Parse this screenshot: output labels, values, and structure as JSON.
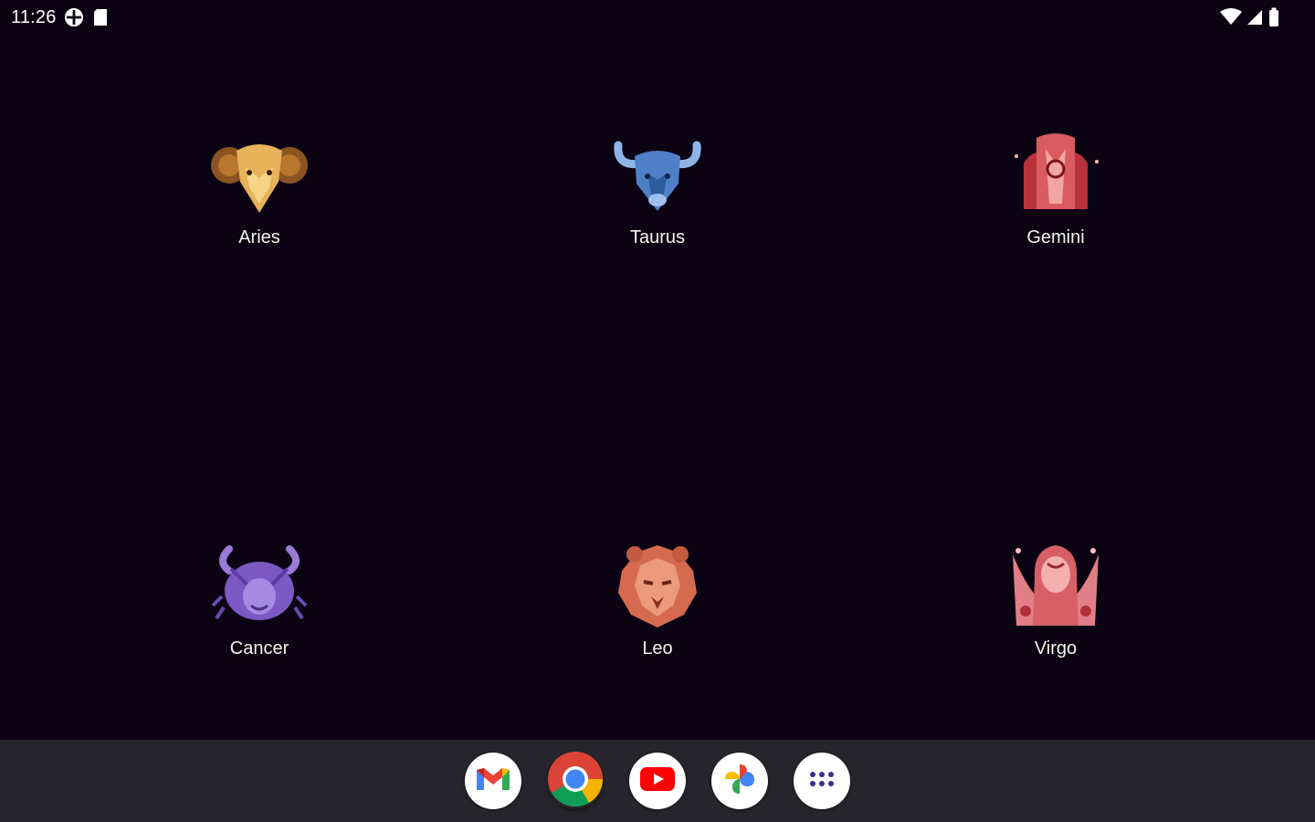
{
  "status_bar": {
    "time": "11:26",
    "left_icons": [
      "vpn-globe-icon",
      "sd-card-icon"
    ],
    "right_icons": [
      "wifi-icon",
      "cell-signal-icon",
      "battery-icon"
    ]
  },
  "apps": [
    {
      "label": "Aries",
      "icon": "aries-ram-icon"
    },
    {
      "label": "Taurus",
      "icon": "taurus-bull-icon"
    },
    {
      "label": "Gemini",
      "icon": "gemini-twins-icon"
    },
    {
      "label": "Cancer",
      "icon": "cancer-crab-icon"
    },
    {
      "label": "Leo",
      "icon": "leo-lion-icon"
    },
    {
      "label": "Virgo",
      "icon": "virgo-maiden-icon"
    }
  ],
  "dock": {
    "items": [
      "gmail-icon",
      "chrome-icon",
      "youtube-icon",
      "photos-icon",
      "app-drawer-icon"
    ]
  },
  "colors": {
    "background": "#0b0313",
    "dock": "#25252b",
    "aries": "#e7b25a",
    "taurus": "#4f7fc6",
    "gemini": "#b8333b",
    "cancer": "#7b58c4",
    "leo": "#d66a4e",
    "virgo": "#e27f86"
  }
}
